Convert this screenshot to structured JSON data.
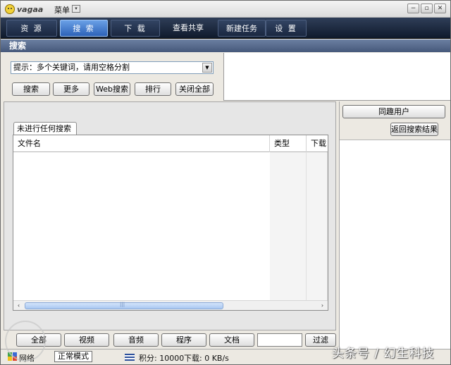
{
  "titlebar": {
    "logo_text": "vagaa",
    "menu_label": "菜单",
    "menu_drop_glyph": "▾",
    "window_buttons": [
      "−",
      "▫",
      "✕"
    ]
  },
  "nav": {
    "tabs": [
      {
        "label": "资 源"
      },
      {
        "label": "搜 索"
      },
      {
        "label": "下 载"
      },
      {
        "label": "查看共享"
      },
      {
        "label": "新建任务"
      },
      {
        "label": "设 置"
      }
    ]
  },
  "section_header": "搜索",
  "search": {
    "combo_value": "提示：多个关键词，请用空格分割",
    "buttons": [
      "搜索",
      "更多",
      "Web搜索",
      "排行",
      "关闭全部"
    ]
  },
  "results": {
    "tab_label": "未进行任何搜索",
    "columns": [
      "文件名",
      "类型",
      "下载"
    ],
    "scroll_left": "‹",
    "scroll_right": "›",
    "scroll_grip": "|||"
  },
  "filters": {
    "buttons": [
      "全部",
      "视频",
      "音频",
      "程序",
      "文档"
    ],
    "filter_label": "过滤"
  },
  "right_panel": {
    "similar_users_button": "同趣用户",
    "back_button": "返回搜索结果"
  },
  "status": {
    "network_label": "网络",
    "mode_label": "正常模式",
    "score_text": "积分: 10000",
    "download_text": "下载: 0 KB/s"
  },
  "watermark": "头条号 / 幻生科技",
  "colors": {
    "nav_bg": "#0f1a2c",
    "nav_active": "#2d62b8",
    "section_header": "#46597b",
    "scroll_thumb": "#a9c7f1"
  }
}
